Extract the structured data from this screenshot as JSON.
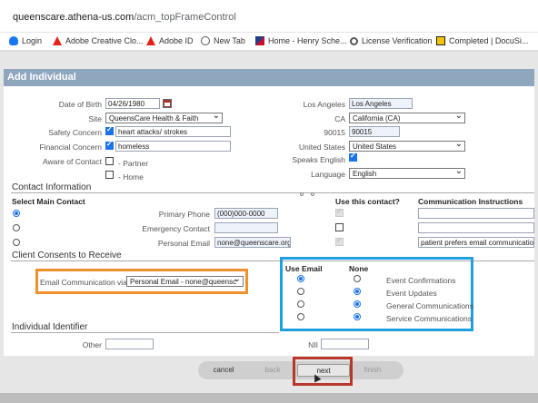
{
  "browser": {
    "url_host": "queenscare.athena-us.com",
    "url_path": "/acm_topFrameControl",
    "bookmarks": [
      {
        "label": "Login",
        "icon": "cloud-icon"
      },
      {
        "label": "Adobe Creative Clo...",
        "icon": "adobe-icon"
      },
      {
        "label": "Adobe ID",
        "icon": "adobe-icon"
      },
      {
        "label": "New Tab",
        "icon": "globe-icon"
      },
      {
        "label": "Home - Henry Sche...",
        "icon": "flag-icon"
      },
      {
        "label": "License Verification",
        "icon": "gear-icon"
      },
      {
        "label": "Completed | DocuSi...",
        "icon": "download-icon"
      }
    ]
  },
  "form": {
    "title": "Add Individual",
    "dob": {
      "label": "Date of Birth",
      "value": "04/26/1980"
    },
    "site": {
      "label": "Site",
      "value": "QueensCare Health & Faith"
    },
    "safety": {
      "label": "Safety Concern",
      "value": "heart attacks/ strokes"
    },
    "financial": {
      "label": "Financial Concern",
      "value": "homeless"
    },
    "aware": {
      "label": "Aware of Contact",
      "options": [
        "- Partner",
        "- Home"
      ]
    },
    "city": {
      "label": "Los Angeles",
      "value": "Los Angeles"
    },
    "state": {
      "label": "CA",
      "value": "California (CA)"
    },
    "zip": {
      "label": "90015",
      "value": "90015"
    },
    "country": {
      "label": "United States",
      "value": "United States"
    },
    "speaks_english": {
      "label": "Speaks English"
    },
    "language": {
      "label": "Language",
      "value": "English"
    },
    "contact_section": "Contact Information",
    "contact_headers": {
      "main": "Select Main Contact",
      "use": "Use this contact?",
      "instructions": "Communication Instructions"
    },
    "contacts": [
      {
        "label": "Primary Phone",
        "value": "(000)000-0000",
        "instruction": ""
      },
      {
        "label": "Emergency Contact",
        "value": "",
        "instruction": ""
      },
      {
        "label": "Personal Email",
        "value": "none@queenscare.org",
        "instruction": "patient prefers email communicatio"
      }
    ],
    "consents_section": "Client Consents to Receive",
    "email_comm": {
      "label": "Email Communication via",
      "value": "Personal Email - none@queensc"
    },
    "consent_headers": {
      "use_email": "Use Email",
      "none": "None"
    },
    "consents": [
      {
        "label": "Event Confirmations",
        "use_email": true
      },
      {
        "label": "Event Updates",
        "use_email": false
      },
      {
        "label": "General Communications",
        "use_email": false
      },
      {
        "label": "Service Communications",
        "use_email": false
      }
    ],
    "identifier_section": "Individual Identifier",
    "other": {
      "label": "Other",
      "value": ""
    },
    "nii": {
      "label": "NII",
      "value": ""
    }
  },
  "buttons": {
    "cancel": "cancel",
    "back": "back",
    "next": "next",
    "finish": "finish"
  },
  "colors": {
    "title_bar": "#8fa6bf",
    "highlight_orange": "#f0902a",
    "highlight_blue": "#1fa0e0",
    "highlight_red": "#b8362a"
  }
}
